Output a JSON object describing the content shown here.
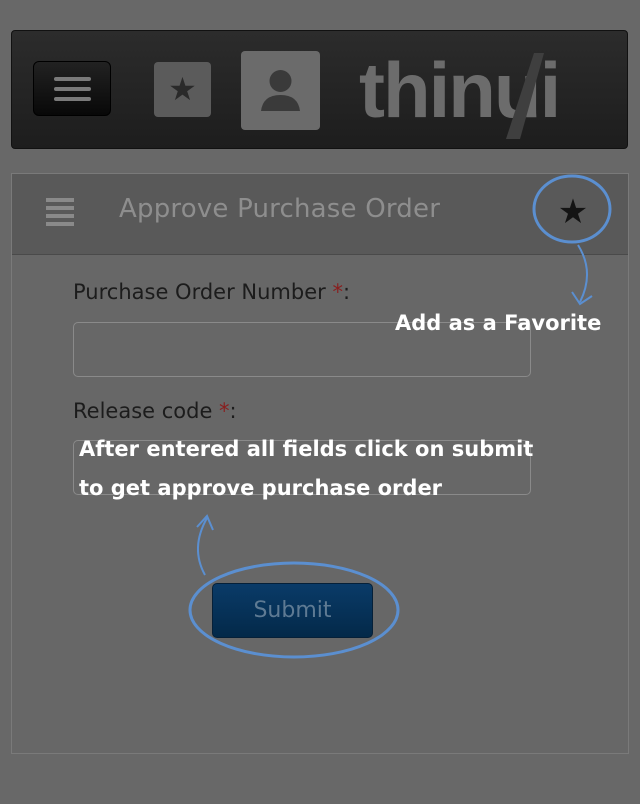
{
  "header": {
    "menu_icon": "hamburger-icon",
    "favorites_icon": "star-icon",
    "profile_icon": "user-icon",
    "logo_text": "thinui"
  },
  "panel": {
    "menu_icon": "list-icon",
    "title": "Approve Purchase Order",
    "favorite_icon": "star-icon"
  },
  "form": {
    "po_number": {
      "label": "Purchase Order Number ",
      "required_mark": "*",
      "suffix": ":",
      "value": ""
    },
    "release_code": {
      "label": "Release code ",
      "required_mark": "*",
      "suffix": ":",
      "value": ""
    },
    "submit_label": "Submit"
  },
  "annotations": {
    "favorite_note": "Add as a Favorite",
    "submit_note_line1": "After entered all fields click on submit",
    "submit_note_line2": "to get approve purchase order",
    "highlight_color": "#5b8fd0"
  }
}
